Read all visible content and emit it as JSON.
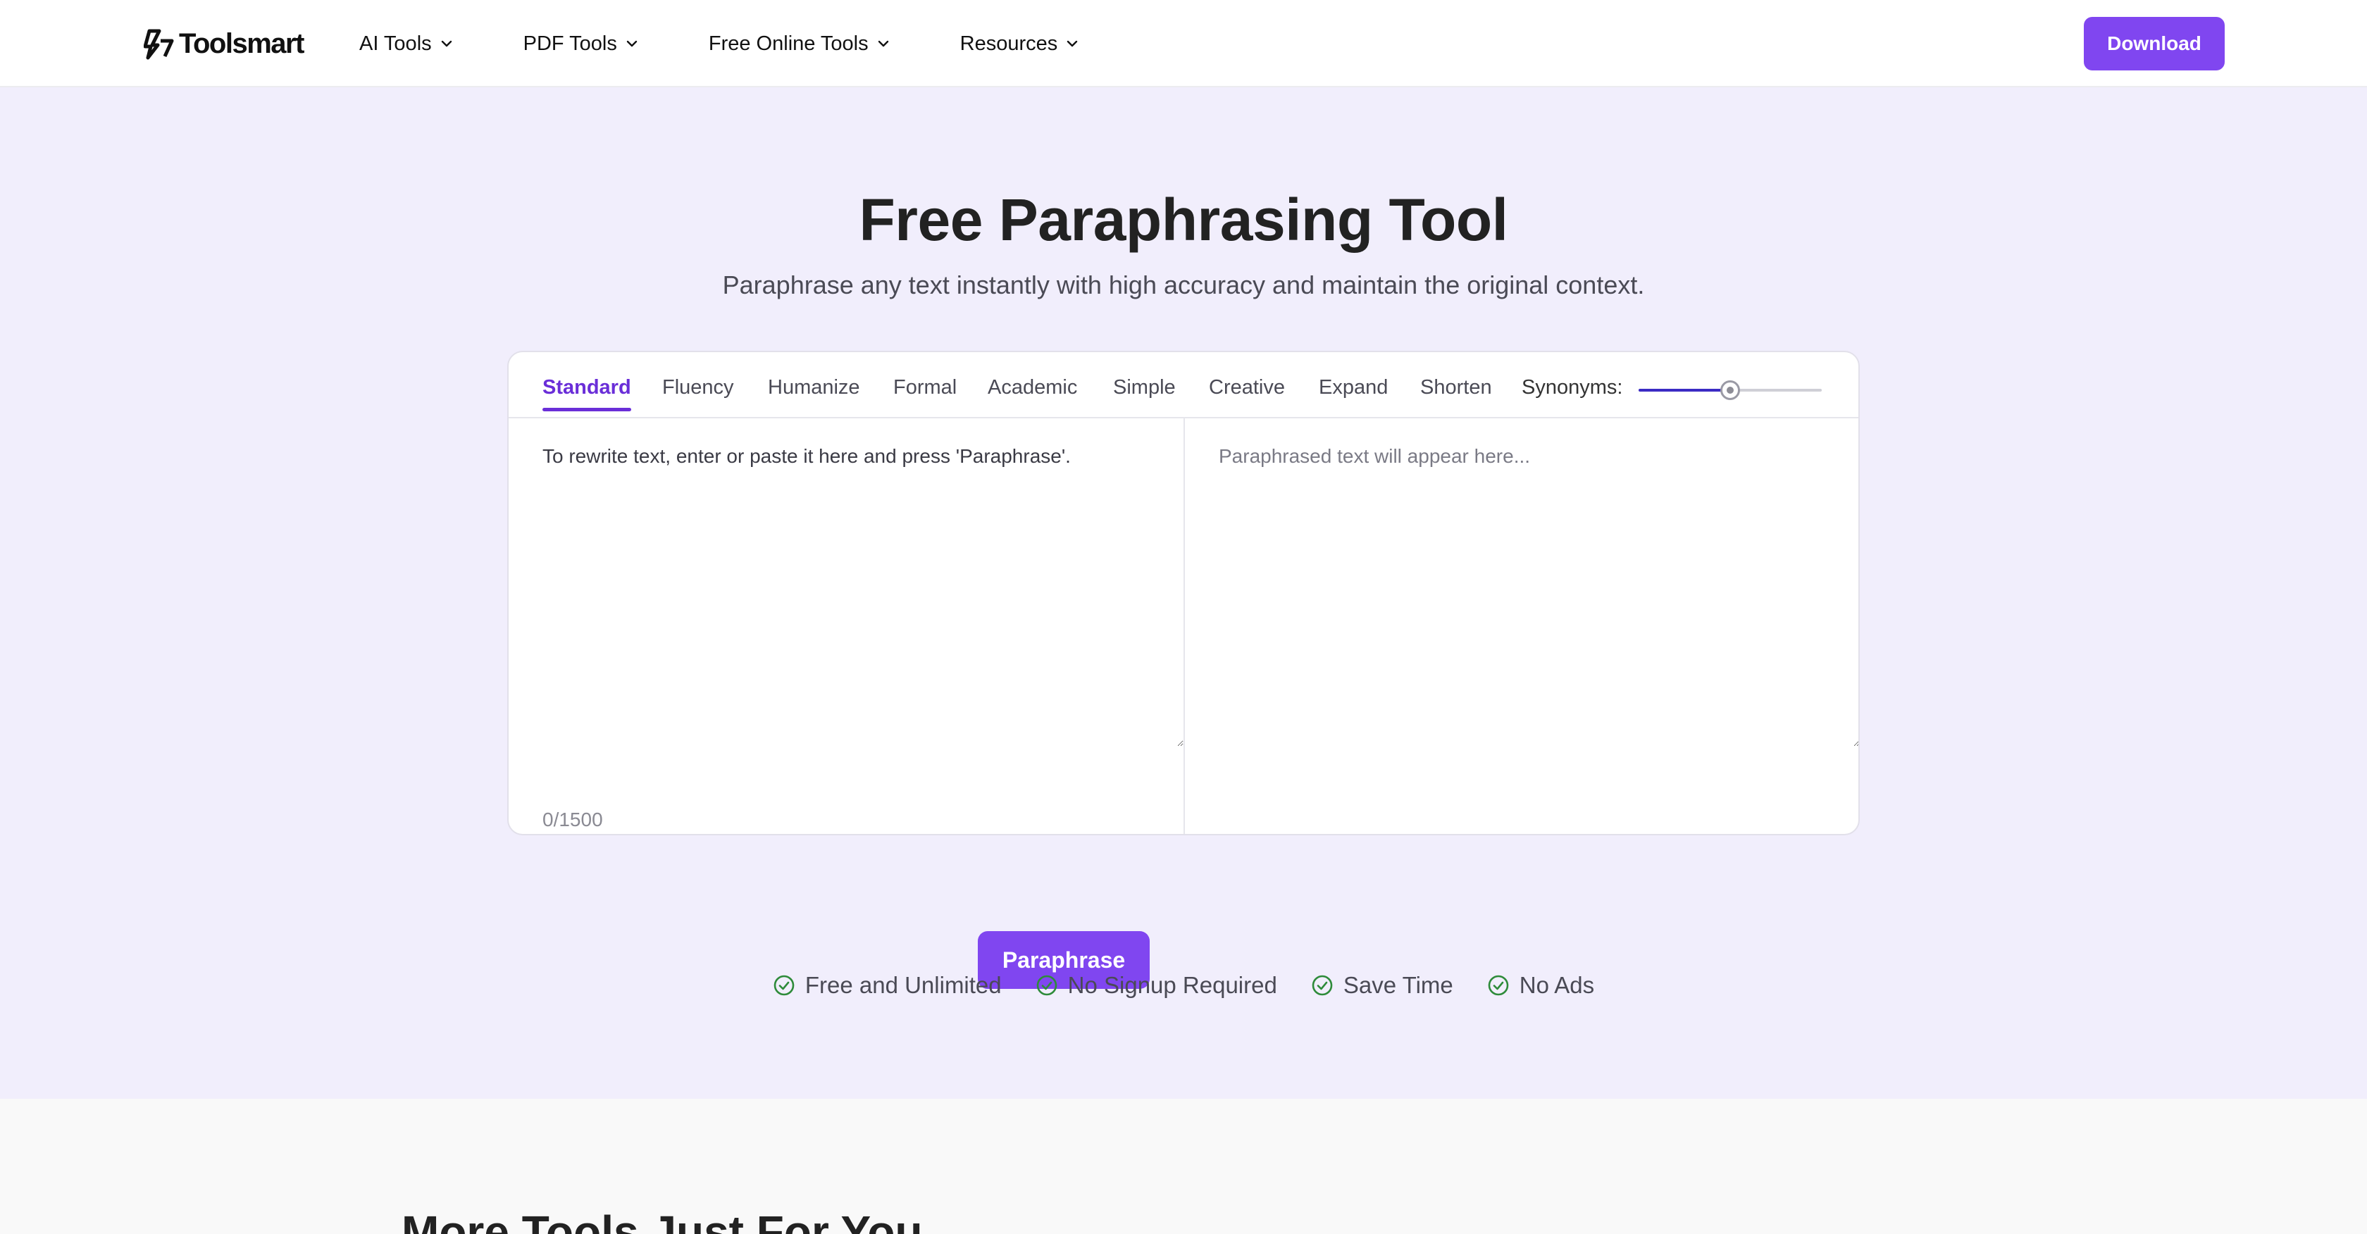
{
  "brand": {
    "name": "Toolsmart"
  },
  "nav": {
    "items": [
      {
        "label": "AI Tools"
      },
      {
        "label": "PDF Tools"
      },
      {
        "label": "Free Online Tools"
      },
      {
        "label": "Resources"
      }
    ],
    "download_label": "Download"
  },
  "hero": {
    "title": "Free Paraphrasing Tool",
    "subtitle": "Paraphrase any text instantly with high accuracy and maintain the original context."
  },
  "tool": {
    "modes": [
      {
        "label": "Standard",
        "active": true
      },
      {
        "label": "Fluency",
        "active": false
      },
      {
        "label": "Humanize",
        "active": false
      },
      {
        "label": "Formal",
        "active": false
      },
      {
        "label": "Academic",
        "active": false
      },
      {
        "label": "Simple",
        "active": false
      },
      {
        "label": "Creative",
        "active": false
      },
      {
        "label": "Expand",
        "active": false
      },
      {
        "label": "Shorten",
        "active": false
      }
    ],
    "synonyms_label": "Synonyms:",
    "synonyms_level": 0.5,
    "input_placeholder": "To rewrite text, enter or paste it here and press 'Paraphrase'.",
    "output_placeholder": "Paraphrased text will appear here...",
    "char_count": "0/1500",
    "paraphrase_label": "Paraphrase"
  },
  "features": [
    {
      "label": "Free and Unlimited"
    },
    {
      "label": "No Signup Required"
    },
    {
      "label": "Save Time"
    },
    {
      "label": "No Ads"
    }
  ],
  "more_tools": {
    "title": "More Tools Just For You"
  },
  "colors": {
    "accent": "#8046f0",
    "active_tab": "#6a2ed8",
    "hero_bg": "#f1eefc",
    "check_green": "#2e8b3a"
  }
}
